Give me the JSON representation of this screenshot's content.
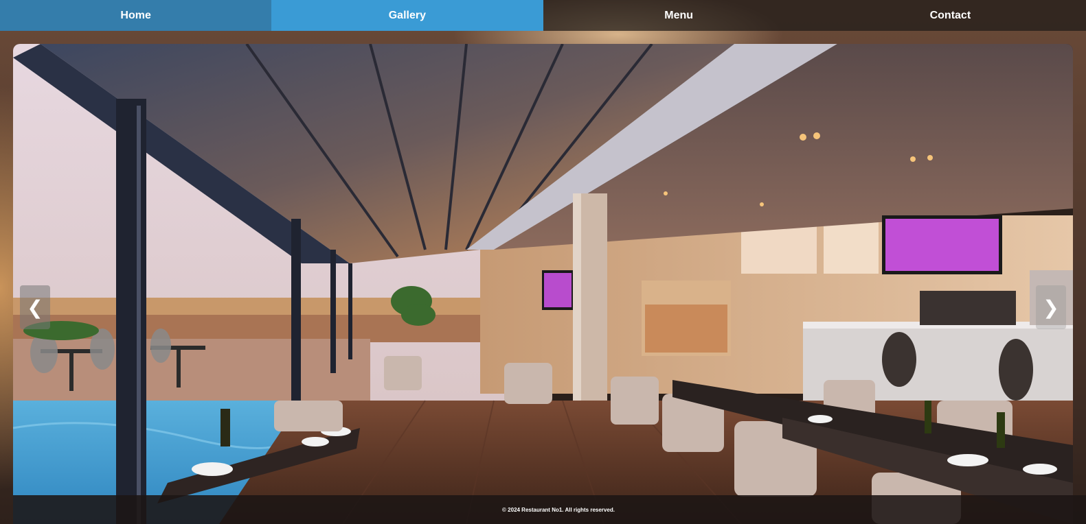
{
  "nav": {
    "items": [
      {
        "label": "Home"
      },
      {
        "label": "Gallery"
      },
      {
        "label": "Menu"
      },
      {
        "label": "Contact"
      }
    ],
    "active": "Gallery",
    "accent": "#3a9bd5"
  },
  "slider": {
    "image_alt": "Restaurant interior with pool view",
    "prev_symbol": "❮",
    "next_symbol": "❯"
  },
  "footer": {
    "text": "© 2024 Restaurant No1. All rights reserved."
  }
}
